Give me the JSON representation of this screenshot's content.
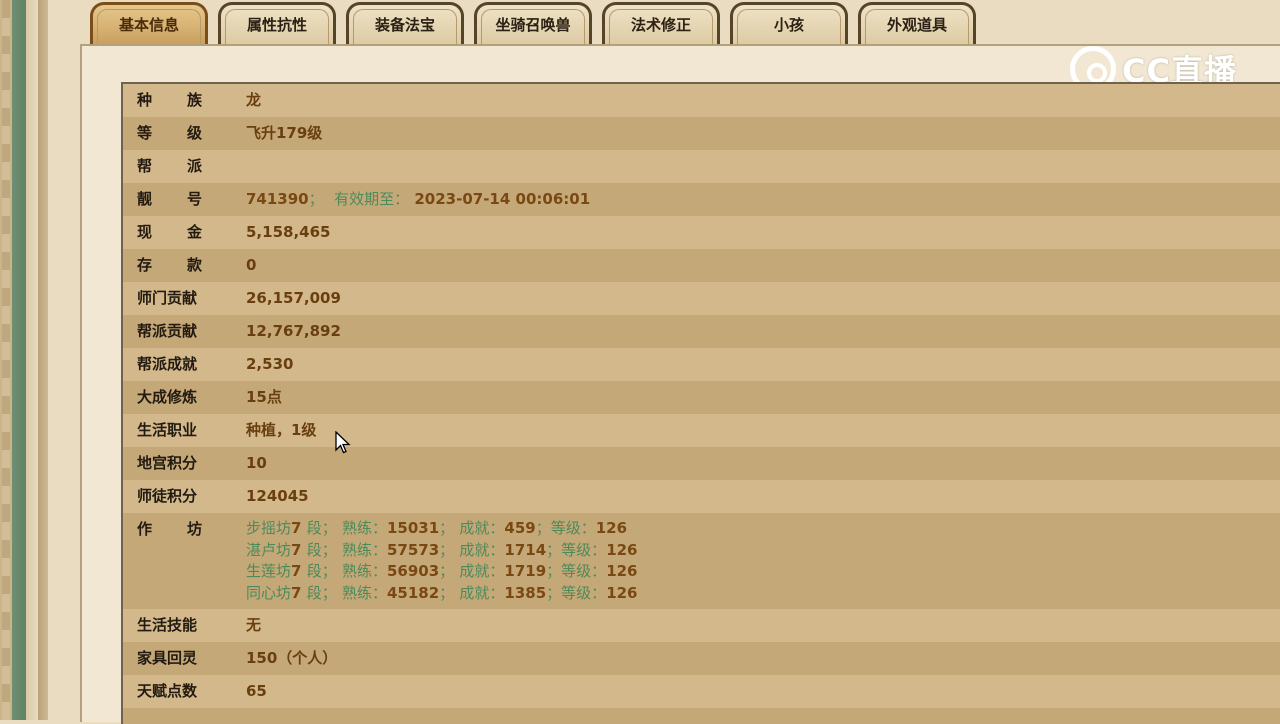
{
  "tabs": [
    {
      "label": "基本信息",
      "active": true
    },
    {
      "label": "属性抗性",
      "active": false
    },
    {
      "label": "装备法宝",
      "active": false
    },
    {
      "label": "坐骑召唤兽",
      "active": false
    },
    {
      "label": "法术修正",
      "active": false
    },
    {
      "label": "小孩",
      "active": false
    },
    {
      "label": "外观道具",
      "active": false
    }
  ],
  "logo": {
    "text": "CC直播",
    "icon": "cc-live-logo-icon"
  },
  "info": {
    "race": {
      "label1": "种",
      "label2": "族",
      "value": "龙"
    },
    "level": {
      "label1": "等",
      "label2": "级",
      "value": "飞升179级"
    },
    "guild": {
      "label1": "帮",
      "label2": "派",
      "value": ""
    },
    "id": {
      "label1": "靓",
      "label2": "号",
      "value": "741390",
      "sep": "；",
      "expiry_label": "有效期至：",
      "expiry_value": "2023-07-14 00:06:01"
    },
    "cash": {
      "label1": "现",
      "label2": "金",
      "value": "5,158,465"
    },
    "deposit": {
      "label1": "存",
      "label2": "款",
      "value": "0"
    },
    "sect_contribution": {
      "label": "师门贡献",
      "value": "26,157,009"
    },
    "guild_contribution": {
      "label": "帮派贡献",
      "value": "12,767,892"
    },
    "guild_achievement": {
      "label": "帮派成就",
      "value": "2,530"
    },
    "master_training": {
      "label": "大成修炼",
      "value": "15点"
    },
    "life_job": {
      "label": "生活职业",
      "value": "种植，1级"
    },
    "palace_points": {
      "label": "地宫积分",
      "value": "10"
    },
    "apprentice_points": {
      "label": "师徒积分",
      "value": "124045"
    },
    "workshop": {
      "label1": "作",
      "label2": "坊",
      "rows": [
        {
          "name": "步摇坊",
          "stage": "7",
          "stage_unit": "段；",
          "prof_label": "熟练：",
          "prof": "15031",
          "ach_label": "成就：",
          "ach": "459",
          "lvl_label": "等级：",
          "lvl": "126"
        },
        {
          "name": "湛卢坊",
          "stage": "7",
          "stage_unit": "段；",
          "prof_label": "熟练：",
          "prof": "57573",
          "ach_label": "成就：",
          "ach": "1714",
          "lvl_label": "等级：",
          "lvl": "126"
        },
        {
          "name": "生莲坊",
          "stage": "7",
          "stage_unit": "段；",
          "prof_label": "熟练：",
          "prof": "56903",
          "ach_label": "成就：",
          "ach": "1719",
          "lvl_label": "等级：",
          "lvl": "126"
        },
        {
          "name": "同心坊",
          "stage": "7",
          "stage_unit": "段；",
          "prof_label": "熟练：",
          "prof": "45182",
          "ach_label": "成就：",
          "ach": "1385",
          "lvl_label": "等级：",
          "lvl": "126"
        }
      ]
    },
    "life_skill": {
      "label": "生活技能",
      "value": "无"
    },
    "furniture": {
      "label": "家具回灵",
      "value": "150（个人）"
    },
    "talent": {
      "label": "天赋点数",
      "value": "65"
    }
  },
  "colors": {
    "accent_gold": "#f2cf3a",
    "value_brown": "#7a4812",
    "value_green": "#4d8a5a",
    "row_light": "#d3b88b",
    "row_dark": "#c5a878"
  }
}
